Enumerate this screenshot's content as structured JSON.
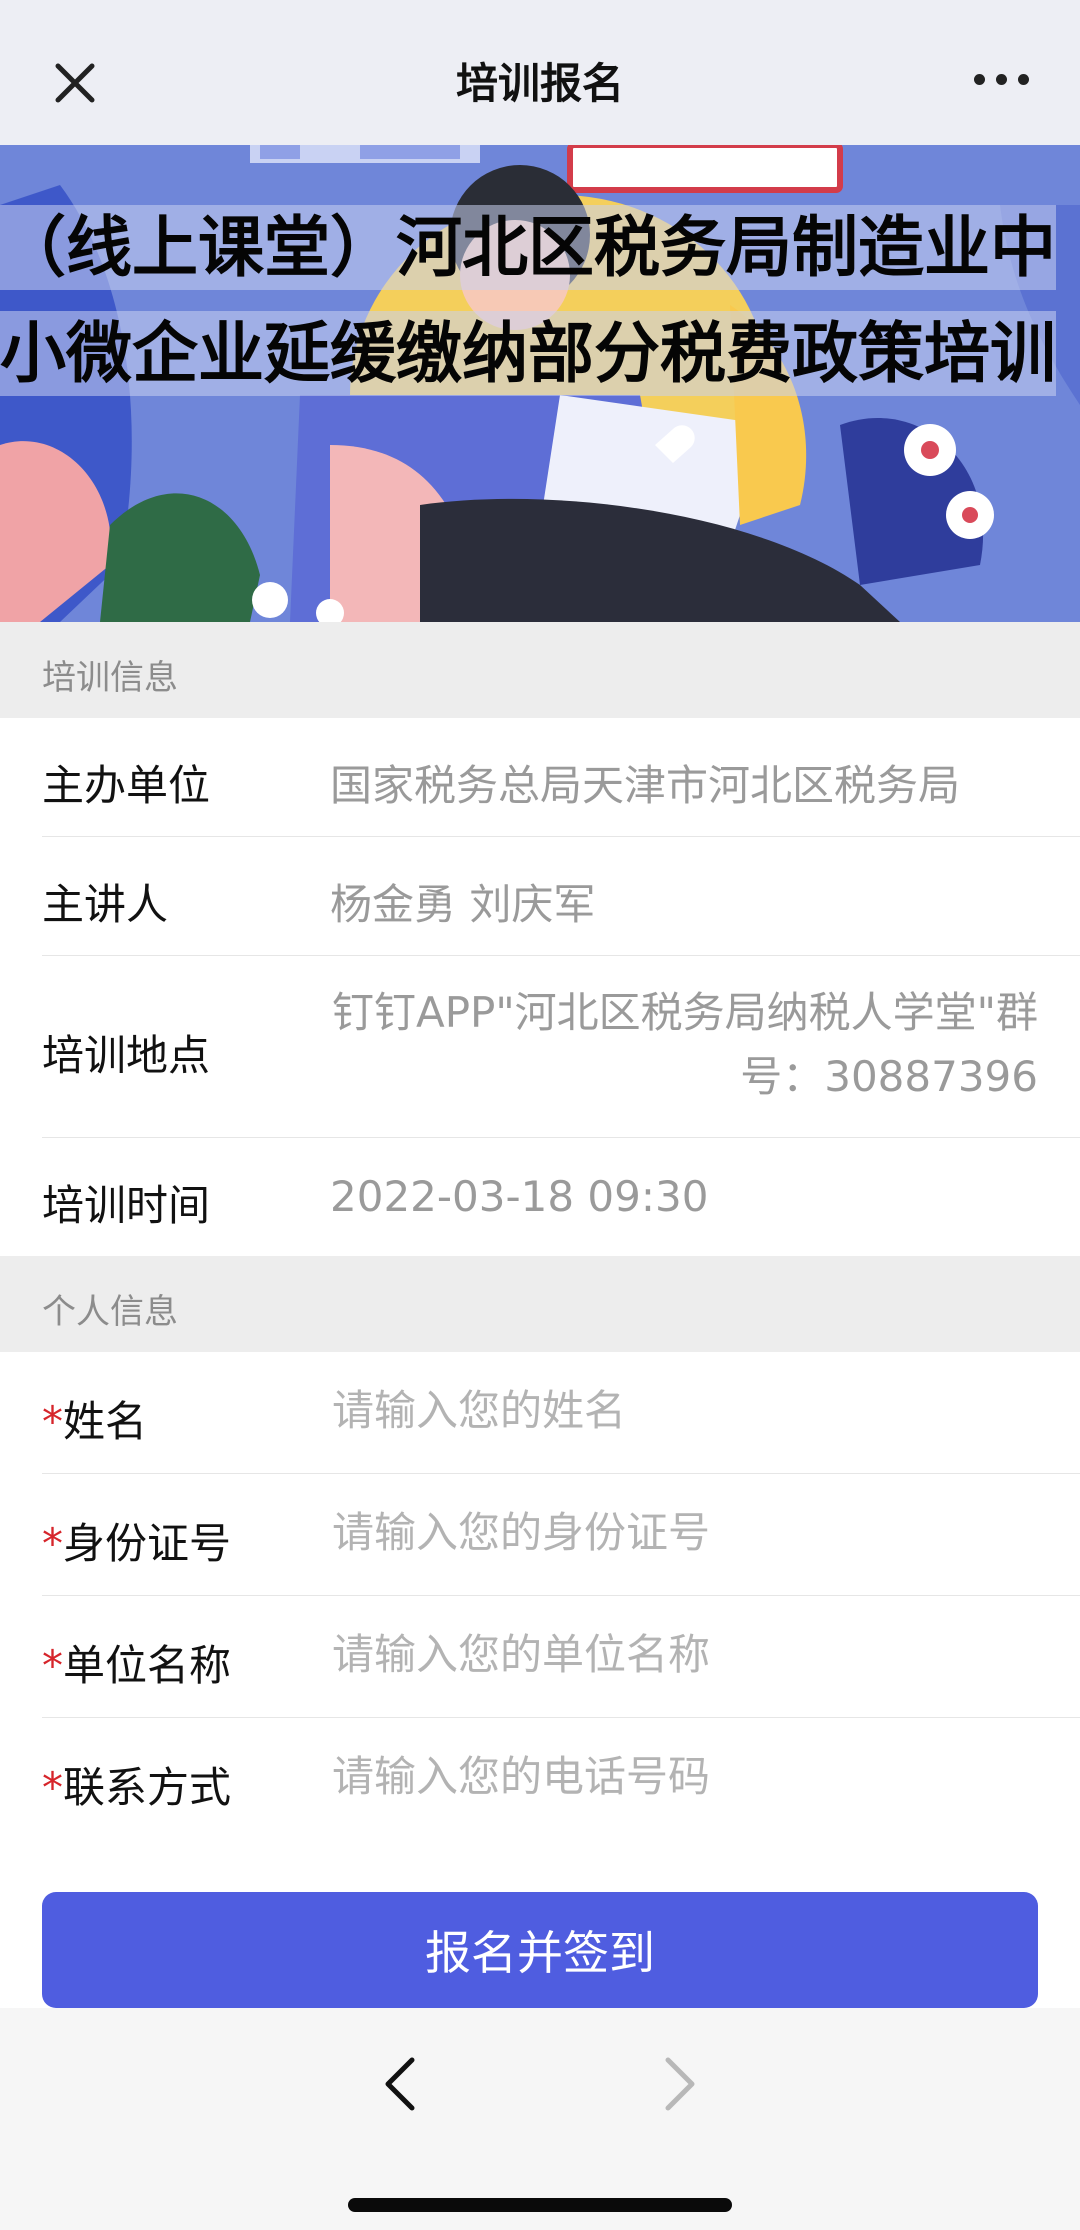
{
  "navbar": {
    "title": "培训报名",
    "close_icon": "close-icon",
    "more_icon": "more-dots-icon"
  },
  "banner": {
    "title": "（线上课堂）河北区税务局制造业中小微企业延缓缴纳部分税费政策培训"
  },
  "training_info": {
    "section_title": "培训信息",
    "rows": [
      {
        "label": "主办单位",
        "value": "国家税务总局天津市河北区税务局"
      },
      {
        "label": "主讲人",
        "value": "杨金勇 刘庆军"
      },
      {
        "label": "培训地点",
        "value": "钉钉APP\"河北区税务局纳税人学堂\"群号：30887396"
      },
      {
        "label": "培训时间",
        "value": "2022-03-18 09:30"
      }
    ]
  },
  "personal_info": {
    "section_title": "个人信息",
    "required_mark": "*",
    "fields": [
      {
        "label": "姓名",
        "value": "",
        "placeholder": "请输入您的姓名"
      },
      {
        "label": "身份证号",
        "value": "",
        "placeholder": "请输入您的身份证号"
      },
      {
        "label": "单位名称",
        "value": "",
        "placeholder": "请输入您的单位名称"
      },
      {
        "label": "联系方式",
        "value": "",
        "placeholder": "请输入您的电话号码"
      }
    ]
  },
  "submit_label": "报名并签到",
  "colors": {
    "accent": "#4f5de0",
    "required": "#d6252b",
    "section_bg": "#ededed"
  },
  "bottom_bar": {
    "back_icon": "chevron-left-icon",
    "forward_icon": "chevron-right-icon"
  }
}
